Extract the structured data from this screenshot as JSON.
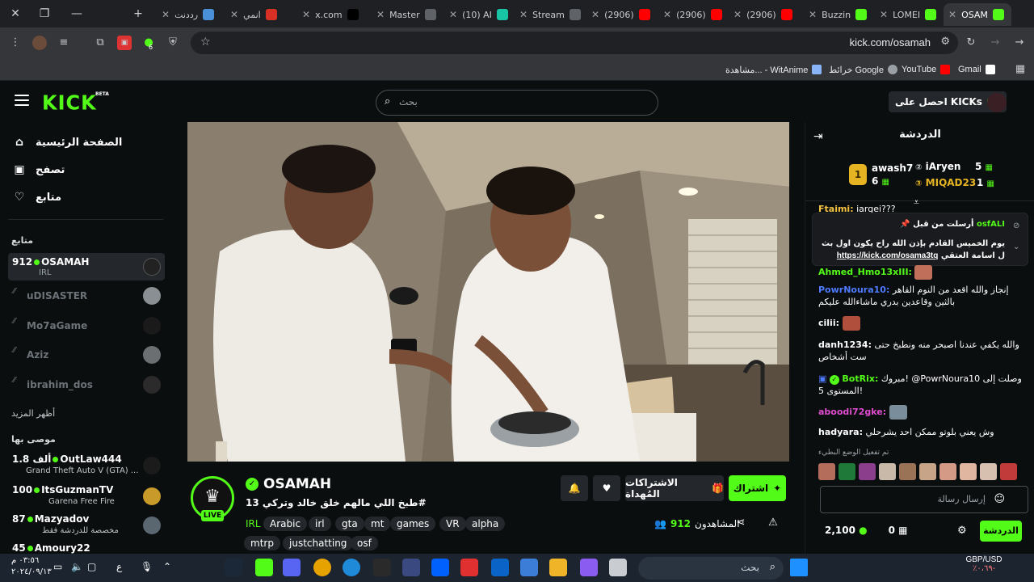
{
  "browser": {
    "tabs": [
      {
        "label": "رددنت",
        "fav": "#4a90d9"
      },
      {
        "label": "انمي",
        "fav": "#d93025"
      },
      {
        "label": "x.com",
        "fav": "#000000"
      },
      {
        "label": "Master",
        "fav": "#5f6368"
      },
      {
        "label": "(10) AI",
        "fav": "#18c4a4"
      },
      {
        "label": "Stream",
        "fav": "#5f6368"
      },
      {
        "label": "(2906)",
        "fav": "#ff0000"
      },
      {
        "label": "(2906)",
        "fav": "#ff0000"
      },
      {
        "label": "(2906)",
        "fav": "#ff0000"
      },
      {
        "label": "Buzzin",
        "fav": "#53fc18"
      },
      {
        "label": "LOMEI",
        "fav": "#53fc18"
      },
      {
        "label": "OSAM",
        "fav": "#53fc18"
      }
    ],
    "url": "kick.com/osamah",
    "extension_badge": "6",
    "bookmarks": [
      "Gmail",
      "YouTube",
      "خرائط Google",
      "مشاهدة... - WitAnime"
    ]
  },
  "header": {
    "logo": "KICK",
    "logo_badge": "BETA",
    "search_placeholder": "بحث",
    "get_kicks": "احصل على KICKs"
  },
  "sidebar": {
    "nav": [
      {
        "label": "الصفحة الرئيسية",
        "icon": "home-icon"
      },
      {
        "label": "تصفح",
        "icon": "browse-icon"
      },
      {
        "label": "متابع",
        "icon": "heart-icon"
      }
    ],
    "following_heading": "متابع",
    "following": [
      {
        "name": "OSAMAH",
        "viewers": "912",
        "sub": "IRL",
        "live": true
      },
      {
        "name": "uDISASTER",
        "live": false
      },
      {
        "name": "Mo7aGame",
        "live": false
      },
      {
        "name": "Aziz",
        "live": false
      },
      {
        "name": "ibrahim_dos",
        "live": false
      }
    ],
    "show_more": "أظهر المزيد",
    "recommended_heading": "موصى بها",
    "recommended": [
      {
        "name": "OutLaw444",
        "viewers": "1.8 ألف",
        "sub": "Grand Theft Auto V (GTA) ..."
      },
      {
        "name": "ItsGuzmanTV",
        "viewers": "100",
        "sub": "Garena Free Fire"
      },
      {
        "name": "Mazyadov",
        "viewers": "87",
        "sub": "مخصصة للدردشة فقط"
      },
      {
        "name": "Amoury22",
        "viewers": "45",
        "sub": ""
      }
    ]
  },
  "stream": {
    "name": "OSAMAH",
    "live": "LIVE",
    "title": "طبخ اللي مالهم خلق خالد وتركي 13#",
    "category": "IRL",
    "tags": [
      "Arabic",
      "irl",
      "gta",
      "mt",
      "games",
      "VR",
      "alpha",
      "mtrp",
      "justchatting",
      "osf"
    ],
    "subscribe": "اشتراك",
    "gift_subs": "الاشتراكات المُهداة",
    "viewers_label": "المشاهدون",
    "viewers_count": "912"
  },
  "chat": {
    "title": "الدردشة",
    "leaderboard": [
      {
        "name": "awash7",
        "gifts": "6",
        "rank": "1"
      },
      {
        "name": "iAryen",
        "gifts": "5",
        "rank": "2"
      },
      {
        "name": "MIQAD23",
        "gifts": "1",
        "rank": "3"
      }
    ],
    "pinned": {
      "header": "أرسلت من قبل",
      "user": "osfALI",
      "message": "يوم الخميس القادم بإذن الله راح يكون اول بث ل اسامة العتقي",
      "link": "https://kick.com/osama3tq"
    },
    "messages": [
      {
        "user": "Ftaimi:",
        "text": "iargei???",
        "color": "#f5c242"
      },
      {
        "user": "Ahmed_Hmo13xIII:",
        "text": "",
        "color": "#53fc18"
      },
      {
        "user": "PowrNoura10:",
        "text": "إنجاز والله اقعد من النوم القاهر بالثين وقاعدين بدري ماشاءالله عليكم",
        "color": "#4e7bff"
      },
      {
        "user": "cilii:",
        "text": "",
        "color": "#ffffff"
      },
      {
        "user": "danh1234:",
        "text": "والله يكفي عندنا اصبحر منه ونطبخ حتى ست أشخاص",
        "color": "#ffffff"
      },
      {
        "user": "BotRix:",
        "text": "مبروك! @PowrNoura10 وصلت إلى المستوى 5!",
        "color": "#53fc18"
      },
      {
        "user": "aboodi72gke:",
        "text": "",
        "color": "#e04ccf"
      },
      {
        "user": "hadyara:",
        "text": "وش يعني بلوتو ممكن احد يشرحلي",
        "color": "#ffffff"
      }
    ],
    "slow_mode": "تم تفعيل الوضع البطيء",
    "input_placeholder": "إرسال رسالة",
    "send": "الدردشة",
    "points": "2,100",
    "subs_count": "0"
  },
  "taskbar": {
    "search_placeholder": "بحث",
    "currency_pair": "GBP/USD",
    "currency_change": "٪٠،٦٩-",
    "time": "٠٣:٥٦ م",
    "date": "٢٠٢٤/٠٩/١٣",
    "lang": "ع"
  },
  "colors": {
    "kick_green": "#53fc18",
    "bg": "#0b0e0f",
    "panel": "#24272c"
  }
}
